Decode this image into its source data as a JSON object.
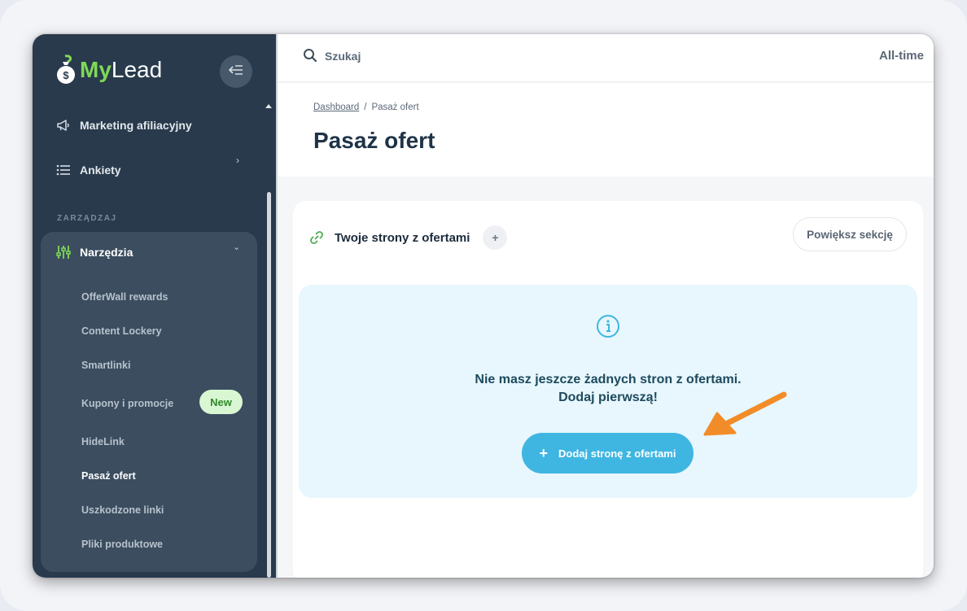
{
  "brand": {
    "name_part1": "My",
    "name_part2": "Lead",
    "accent": "#7ed957"
  },
  "sidebar": {
    "items": [
      {
        "label": "Marketing afiliacyjny",
        "icon": "megaphone-icon"
      },
      {
        "label": "Ankiety",
        "icon": "list-icon"
      }
    ],
    "section_label": "ZARZĄDZAJ",
    "tools": {
      "label": "Narzędzia",
      "icon": "sliders-icon",
      "subitems": [
        {
          "label": "OfferWall rewards"
        },
        {
          "label": "Content Lockery"
        },
        {
          "label": "Smartlinki"
        },
        {
          "label": "Kupony i promocje",
          "badge": "New"
        },
        {
          "label": "HideLink"
        },
        {
          "label": "Pasaż ofert",
          "active": true
        },
        {
          "label": "Uszkodzone linki"
        },
        {
          "label": "Pliki produktowe"
        }
      ]
    }
  },
  "topbar": {
    "search_placeholder": "Szukaj",
    "range": "All-time"
  },
  "breadcrumb": {
    "root": "Dashboard",
    "separator": "/",
    "current": "Pasaż ofert"
  },
  "page": {
    "title": "Pasaż ofert"
  },
  "card": {
    "title": "Twoje strony z ofertami",
    "add_label": "+",
    "enlarge_label": "Powiększ sekcję",
    "empty_line1": "Nie masz jeszcze żadnych stron z ofertami.",
    "empty_line2": "Dodaj pierwszą!",
    "add_button_label": "Dodaj stronę z ofertami",
    "add_button_icon": "+"
  },
  "colors": {
    "sidebar": "#283a4c",
    "primary_button": "#3fb6e2",
    "annotation_arrow": "#f28c28"
  }
}
